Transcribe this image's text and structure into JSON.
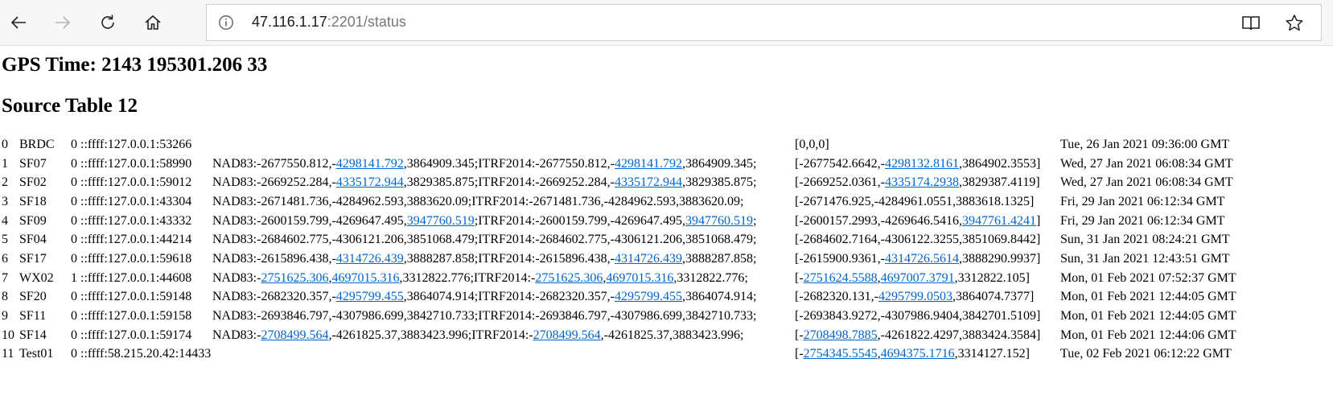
{
  "browser": {
    "url_host": "47.116.1.17",
    "url_port": ":2201",
    "url_path": "/status"
  },
  "page": {
    "gps_time": "GPS Time: 2143 195301.206 33",
    "source_table": "Source Table 12"
  },
  "rows": [
    {
      "idx": "0",
      "name": "BRDC",
      "flag": "0",
      "addr": "::ffff:127.0.0.1:53266",
      "nad": [],
      "est": [
        {
          "t": "[0,0,0]"
        }
      ],
      "time": "Tue, 26 Jan 2021 09:36:00 GMT"
    },
    {
      "idx": "1",
      "name": "SF07",
      "flag": "0",
      "addr": "::ffff:127.0.0.1:58990",
      "nad": [
        {
          "t": "NAD83:-2677550.812,-"
        },
        {
          "t": "4298141.792",
          "l": true
        },
        {
          "t": ",3864909.345;ITRF2014:-2677550.812,-"
        },
        {
          "t": "4298141.792",
          "l": true
        },
        {
          "t": ",3864909.345;"
        }
      ],
      "est": [
        {
          "t": "[-2677542.6642,-"
        },
        {
          "t": "4298132.8161",
          "l": true
        },
        {
          "t": ",3864902.3553]"
        }
      ],
      "time": "Wed, 27 Jan 2021 06:08:34 GMT"
    },
    {
      "idx": "2",
      "name": "SF02",
      "flag": "0",
      "addr": "::ffff:127.0.0.1:59012",
      "nad": [
        {
          "t": "NAD83:-2669252.284,-"
        },
        {
          "t": "4335172.944",
          "l": true
        },
        {
          "t": ",3829385.875;ITRF2014:-2669252.284,-"
        },
        {
          "t": "4335172.944",
          "l": true
        },
        {
          "t": ",3829385.875;"
        }
      ],
      "est": [
        {
          "t": "[-2669252.0361,-"
        },
        {
          "t": "4335174.2938",
          "l": true
        },
        {
          "t": ",3829387.4119]"
        }
      ],
      "time": "Wed, 27 Jan 2021 06:08:34 GMT"
    },
    {
      "idx": "3",
      "name": "SF18",
      "flag": "0",
      "addr": "::ffff:127.0.0.1:43304",
      "nad": [
        {
          "t": "NAD83:-2671481.736,-4284962.593,3883620.09;ITRF2014:-2671481.736,-4284962.593,3883620.09;"
        }
      ],
      "est": [
        {
          "t": "[-2671476.925,-4284961.0551,3883618.1325]"
        }
      ],
      "time": "Fri, 29 Jan 2021 06:12:34 GMT"
    },
    {
      "idx": "4",
      "name": "SF09",
      "flag": "0",
      "addr": "::ffff:127.0.0.1:43332",
      "nad": [
        {
          "t": "NAD83:-2600159.799,-4269647.495,"
        },
        {
          "t": "3947760.519",
          "l": true
        },
        {
          "t": ";ITRF2014:-2600159.799,-4269647.495,"
        },
        {
          "t": "3947760.519",
          "l": true
        },
        {
          "t": ";"
        }
      ],
      "est": [
        {
          "t": "[-2600157.2993,-4269646.5416,"
        },
        {
          "t": "3947761.4241",
          "l": true
        },
        {
          "t": "]"
        }
      ],
      "time": "Fri, 29 Jan 2021 06:12:34 GMT"
    },
    {
      "idx": "5",
      "name": "SF04",
      "flag": "0",
      "addr": "::ffff:127.0.0.1:44214",
      "nad": [
        {
          "t": "NAD83:-2684602.775,-4306121.206,3851068.479;ITRF2014:-2684602.775,-4306121.206,3851068.479;"
        }
      ],
      "est": [
        {
          "t": "[-2684602.7164,-4306122.3255,3851069.8442]"
        }
      ],
      "time": "Sun, 31 Jan 2021 08:24:21 GMT"
    },
    {
      "idx": "6",
      "name": "SF17",
      "flag": "0",
      "addr": "::ffff:127.0.0.1:59618",
      "nad": [
        {
          "t": "NAD83:-2615896.438,-"
        },
        {
          "t": "4314726.439",
          "l": true
        },
        {
          "t": ",3888287.858;ITRF2014:-2615896.438,-"
        },
        {
          "t": "4314726.439",
          "l": true
        },
        {
          "t": ",3888287.858;"
        }
      ],
      "est": [
        {
          "t": "[-2615900.9361,-"
        },
        {
          "t": "4314726.5614",
          "l": true
        },
        {
          "t": ",3888290.9937]"
        }
      ],
      "time": "Sun, 31 Jan 2021 12:43:51 GMT"
    },
    {
      "idx": "7",
      "name": "WX02",
      "flag": "1",
      "addr": "::ffff:127.0.0.1:44608",
      "nad": [
        {
          "t": "NAD83:-"
        },
        {
          "t": "2751625.306",
          "l": true
        },
        {
          "t": ","
        },
        {
          "t": "4697015.316",
          "l": true
        },
        {
          "t": ",3312822.776;ITRF2014:-"
        },
        {
          "t": "2751625.306",
          "l": true
        },
        {
          "t": ","
        },
        {
          "t": "4697015.316",
          "l": true
        },
        {
          "t": ",3312822.776;"
        }
      ],
      "est": [
        {
          "t": "[-"
        },
        {
          "t": "2751624.5588",
          "l": true
        },
        {
          "t": ","
        },
        {
          "t": "4697007.3791",
          "l": true
        },
        {
          "t": ",3312822.105]"
        }
      ],
      "time": "Mon, 01 Feb 2021 07:52:37 GMT"
    },
    {
      "idx": "8",
      "name": "SF20",
      "flag": "0",
      "addr": "::ffff:127.0.0.1:59148",
      "nad": [
        {
          "t": "NAD83:-2682320.357,-"
        },
        {
          "t": "4295799.455",
          "l": true
        },
        {
          "t": ",3864074.914;ITRF2014:-2682320.357,-"
        },
        {
          "t": "4295799.455",
          "l": true
        },
        {
          "t": ",3864074.914;"
        }
      ],
      "est": [
        {
          "t": "[-2682320.131,-"
        },
        {
          "t": "4295799.0503",
          "l": true
        },
        {
          "t": ",3864074.7377]"
        }
      ],
      "time": "Mon, 01 Feb 2021 12:44:05 GMT"
    },
    {
      "idx": "9",
      "name": "SF11",
      "flag": "0",
      "addr": "::ffff:127.0.0.1:59158",
      "nad": [
        {
          "t": "NAD83:-2693846.797,-4307986.699,3842710.733;ITRF2014:-2693846.797,-4307986.699,3842710.733;"
        }
      ],
      "est": [
        {
          "t": "[-2693843.9272,-4307986.9404,3842701.5109]"
        }
      ],
      "time": "Mon, 01 Feb 2021 12:44:05 GMT"
    },
    {
      "idx": "10",
      "name": "SF14",
      "flag": "0",
      "addr": "::ffff:127.0.0.1:59174",
      "nad": [
        {
          "t": "NAD83:-"
        },
        {
          "t": "2708499.564",
          "l": true
        },
        {
          "t": ",-4261825.37,3883423.996;ITRF2014:-"
        },
        {
          "t": "2708499.564",
          "l": true
        },
        {
          "t": ",-4261825.37,3883423.996;"
        }
      ],
      "est": [
        {
          "t": "[-"
        },
        {
          "t": "2708498.7885",
          "l": true
        },
        {
          "t": ",-4261822.4297,3883424.3584]"
        }
      ],
      "time": "Mon, 01 Feb 2021 12:44:06 GMT"
    },
    {
      "idx": "11",
      "name": "Test01",
      "flag": "0",
      "addr": "::ffff:58.215.20.42:14433",
      "nad": [],
      "est": [
        {
          "t": "[-"
        },
        {
          "t": "2754345.5545",
          "l": true
        },
        {
          "t": ","
        },
        {
          "t": "4694375.1716",
          "l": true
        },
        {
          "t": ",3314127.152]"
        }
      ],
      "time": "Tue, 02 Feb 2021 06:12:22 GMT"
    }
  ],
  "icons": {
    "back": "back-arrow-icon",
    "forward": "forward-arrow-icon",
    "refresh": "refresh-icon",
    "home": "home-icon",
    "info": "info-icon",
    "reading": "reading-view-icon",
    "favorite": "star-icon"
  },
  "colors": {
    "link": "#0066cc",
    "toolbar": "#f7f7f7"
  }
}
